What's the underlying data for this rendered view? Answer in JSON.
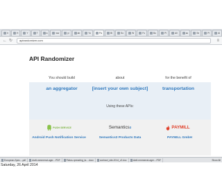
{
  "browser": {
    "tabs": [
      {
        "label": "Ir"
      },
      {
        "label": "H"
      },
      {
        "label": "Y"
      },
      {
        "label": "T"
      },
      {
        "label": "a"
      },
      {
        "label": "ww"
      },
      {
        "label": "yi"
      },
      {
        "label": "ab"
      },
      {
        "label": "Yo"
      },
      {
        "label": "Pa",
        "active": true
      },
      {
        "label": "Bl"
      },
      {
        "label": "So"
      },
      {
        "label": "W"
      },
      {
        "label": "Fo"
      },
      {
        "label": "Bo"
      },
      {
        "label": "Pl"
      },
      {
        "label": "All"
      },
      {
        "label": "ac"
      },
      {
        "label": "Se"
      },
      {
        "label": "Pi"
      },
      {
        "label": "Al"
      }
    ],
    "url": "apirandomizer.com",
    "menu_icon": "menu-icon"
  },
  "page": {
    "title": "API Randomizer",
    "columns": [
      {
        "label": "You should build",
        "value": "an aggregator"
      },
      {
        "label": "about",
        "value": "[insert your own subject]"
      },
      {
        "label": "for the benefit of",
        "value": "transportation"
      }
    ],
    "using_text": "Using these APIs:",
    "apis": [
      {
        "logo_text": "PUSH SERVICE",
        "name": "Android Push Notification Service"
      },
      {
        "logo_text": "Semantics",
        "logo_sup": "3",
        "name": "Semantics3 Products Data"
      },
      {
        "logo_text": "PAYMILL",
        "name": "PAYMILL GmbH"
      }
    ]
  },
  "taskbar": {
    "items": [
      {
        "label": "European-Spec....pdf"
      },
      {
        "label": "draft-mmmerrat-ager....PDF"
      },
      {
        "label": "Flatus-rpreading_ta....docx"
      },
      {
        "label": "contract_site-2014_v2.doc"
      },
      {
        "label": "draft-mmmerrat-ager....PDF"
      }
    ],
    "show_all": "Show All"
  },
  "date_caption": "Saturday, 26 April 2014",
  "colors": {
    "accent": "#2f78bd",
    "hero_band": "#e8eff6",
    "api_band": "#f1f1f1",
    "android_green": "#8bc34a",
    "paymill_red": "#e0402a"
  }
}
